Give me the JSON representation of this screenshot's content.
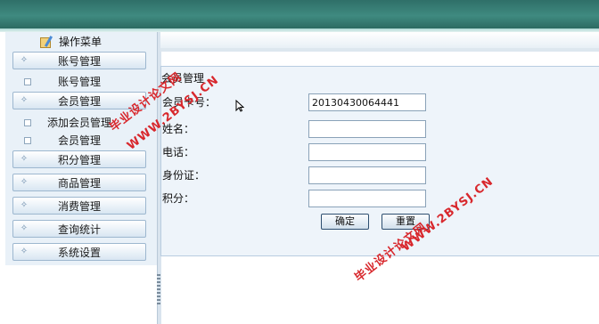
{
  "sidebar": {
    "title": "操作菜单",
    "items": [
      {
        "type": "group",
        "label": "账号管理"
      },
      {
        "type": "sub",
        "label": "账号管理"
      },
      {
        "type": "group",
        "label": "会员管理"
      },
      {
        "type": "sub",
        "label": "添加会员管理"
      },
      {
        "type": "sub",
        "label": "会员管理"
      },
      {
        "type": "group",
        "label": "积分管理"
      },
      {
        "type": "group",
        "label": "商品管理"
      },
      {
        "type": "group",
        "label": "消费管理"
      },
      {
        "type": "group",
        "label": "查询统计"
      },
      {
        "type": "group",
        "label": "系统设置"
      }
    ]
  },
  "form": {
    "title": "会员管理",
    "fields": [
      {
        "label": "会员卡号：",
        "value": "20130430064441"
      },
      {
        "label": "姓名：",
        "value": ""
      },
      {
        "label": "电话：",
        "value": ""
      },
      {
        "label": "身份证：",
        "value": ""
      },
      {
        "label": "积分：",
        "value": ""
      }
    ],
    "submit_label": "确定",
    "reset_label": "重置"
  },
  "watermark": {
    "name": "毕业设计论文网",
    "url": "WWW.2BYSJ.CN"
  },
  "colors": {
    "topbar": "#3f8a80",
    "watermark": "#d8272c",
    "panel": "#eef4fa"
  }
}
